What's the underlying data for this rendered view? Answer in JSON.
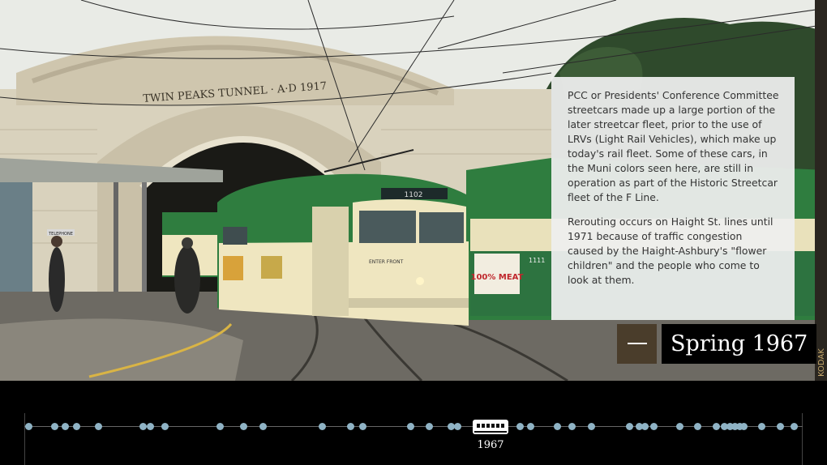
{
  "caption": {
    "paragraph_1": "PCC or Presidents' Conference Committee streetcars made up a large portion of the later streetcar fleet, prior to the use of LRVs (Light Rail Vehicles), which make up today's rail fleet. Some of these cars, in the Muni colors seen here, are still in operation as part of the Historic Streetcar fleet of the F Line.",
    "paragraph_2": "Rerouting occurs on Haight St. lines until 1971 because of traffic congestion caused by the Haight-Ashbury's \"flower children\" and the people who come to look at them."
  },
  "date_label": "Spring 1967",
  "collapse_icon": "minus-icon",
  "photo_text": {
    "tunnel_inscription": "TWIN PEAKS TUNNEL · A·D 1917",
    "car_number": "1102",
    "second_car_number": "1111",
    "ad_text": "100% MEAT",
    "enter_sign": "ENTER FRONT",
    "phone_sign": "TELEPHONE",
    "film_edge": "KODAK"
  },
  "timeline": {
    "selected_year": "1967",
    "dot_count": 46,
    "colors": {
      "dot": "#8fb3c5",
      "marker": "#ffffff",
      "line": "#666666"
    }
  },
  "colors": {
    "streetcar_green": "#2f7d3f",
    "streetcar_cream": "#efe6c0",
    "button_brown": "#4a3d2b"
  }
}
